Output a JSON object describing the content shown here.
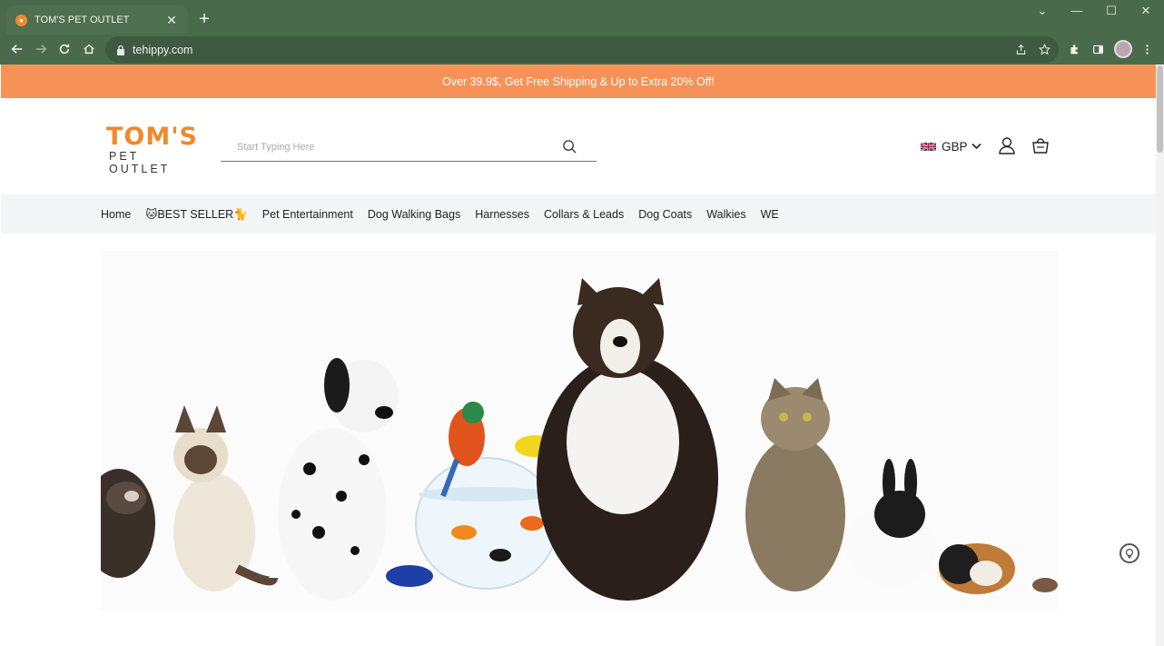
{
  "browser": {
    "tab_title": "TOM'S PET OUTLET",
    "url": "tehippy.com"
  },
  "promo": {
    "text": "Over 39.9$, Get Free Shipping & Up to Extra 20% Off!"
  },
  "header": {
    "logo_top": "TOM'S",
    "logo_bottom": "PET OUTLET",
    "search_placeholder": "Start Typing Here",
    "currency": "GBP"
  },
  "nav": {
    "items": [
      {
        "label": "Home"
      },
      {
        "label": "🐱BEST SELLER🐈"
      },
      {
        "label": "Pet Entertainment"
      },
      {
        "label": "Dog Walking Bags"
      },
      {
        "label": "Harnesses"
      },
      {
        "label": "Collars & Leads"
      },
      {
        "label": "Dog Coats"
      },
      {
        "label": "Walkies"
      },
      {
        "label": "WE"
      }
    ]
  },
  "colors": {
    "chrome": "#4a6a4c",
    "promo": "#f69257",
    "brand": "#f0882c",
    "nav_bg": "#f4f5f7"
  },
  "icons": {
    "search": "search-icon",
    "account": "user-icon",
    "cart": "cart-icon",
    "currency_flag": "uk-flag-icon"
  }
}
